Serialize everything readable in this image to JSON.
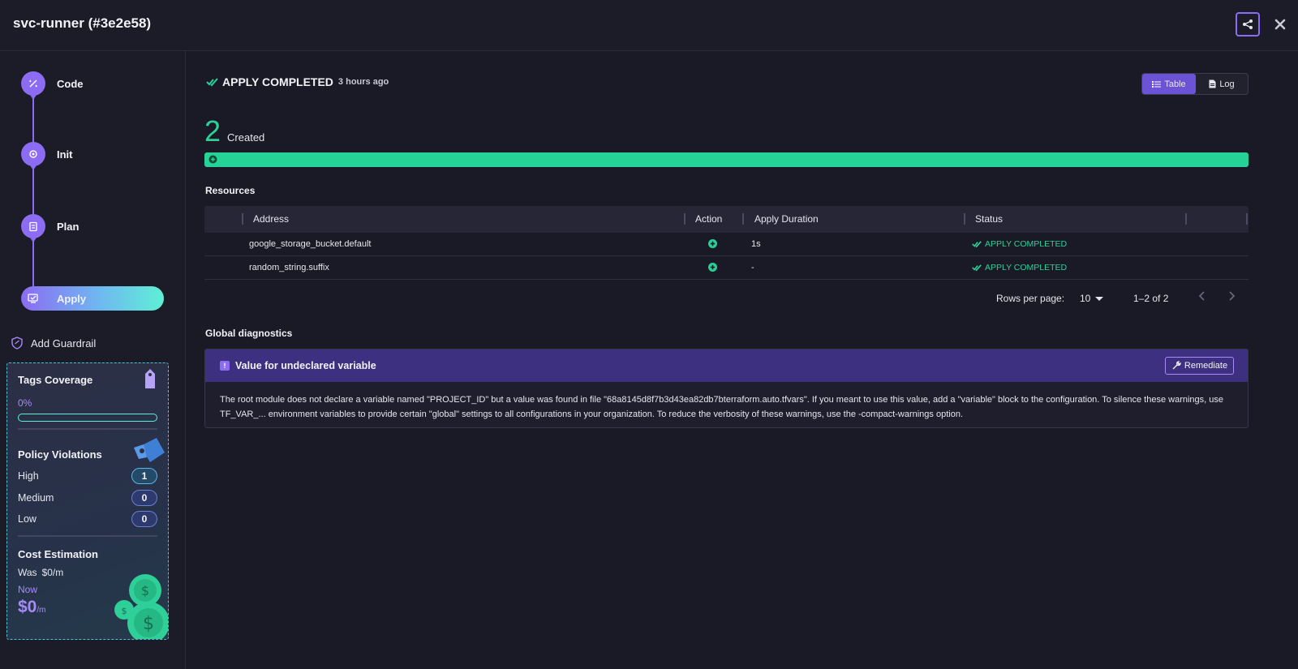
{
  "header": {
    "title": "svc-runner (#3e2e58)"
  },
  "sidebar": {
    "steps": [
      {
        "label": "Code"
      },
      {
        "label": "Init"
      },
      {
        "label": "Plan"
      },
      {
        "label": "Apply"
      }
    ],
    "add_guardrail": "Add Guardrail",
    "tags_coverage": {
      "title": "Tags Coverage",
      "percent_text": "0%",
      "percent": 0
    },
    "policy_violations": {
      "title": "Policy Violations",
      "rows": [
        {
          "label": "High",
          "count": "1"
        },
        {
          "label": "Medium",
          "count": "0"
        },
        {
          "label": "Low",
          "count": "0"
        }
      ]
    },
    "cost_estimation": {
      "title": "Cost Estimation",
      "was_label": "Was",
      "was_value": "$0/m",
      "now_label": "Now",
      "now_value": "$0",
      "now_unit": "/m"
    }
  },
  "main": {
    "status": "APPLY COMPLETED",
    "time_ago": "3 hours ago",
    "view_toggle": {
      "table": "Table",
      "log": "Log",
      "selected": "Table"
    },
    "created_count": "2",
    "created_label": "Created",
    "resources_title": "Resources",
    "table": {
      "columns": [
        "Address",
        "Action",
        "Apply Duration",
        "Status"
      ],
      "rows": [
        {
          "address": "google_storage_bucket.default",
          "action": "create",
          "duration": "1s",
          "status": "APPLY COMPLETED"
        },
        {
          "address": "random_string.suffix",
          "action": "create",
          "duration": "-",
          "status": "APPLY COMPLETED"
        }
      ]
    },
    "pagination": {
      "rows_per_page_label": "Rows per page:",
      "rows_per_page": "10",
      "range": "1–2 of 2"
    },
    "diagnostics_title": "Global diagnostics",
    "diagnostic": {
      "title": "Value for undeclared variable",
      "remediate_label": "Remediate",
      "message": "The root module does not declare a variable named \"PROJECT_ID\" but a value was found in file \"68a8145d8f7b3d43ea82db7bterraform.auto.tfvars\". If you meant to use this value, add a \"variable\" block to the configuration. To silence these warnings, use TF_VAR_... environment variables to provide certain \"global\" settings to all configurations in your organization. To reduce the verbosity of these warnings, use the -compact-warnings option."
    }
  },
  "colors": {
    "accent": "#8b6cf2",
    "success": "#25d396",
    "background": "#1a1a26"
  }
}
